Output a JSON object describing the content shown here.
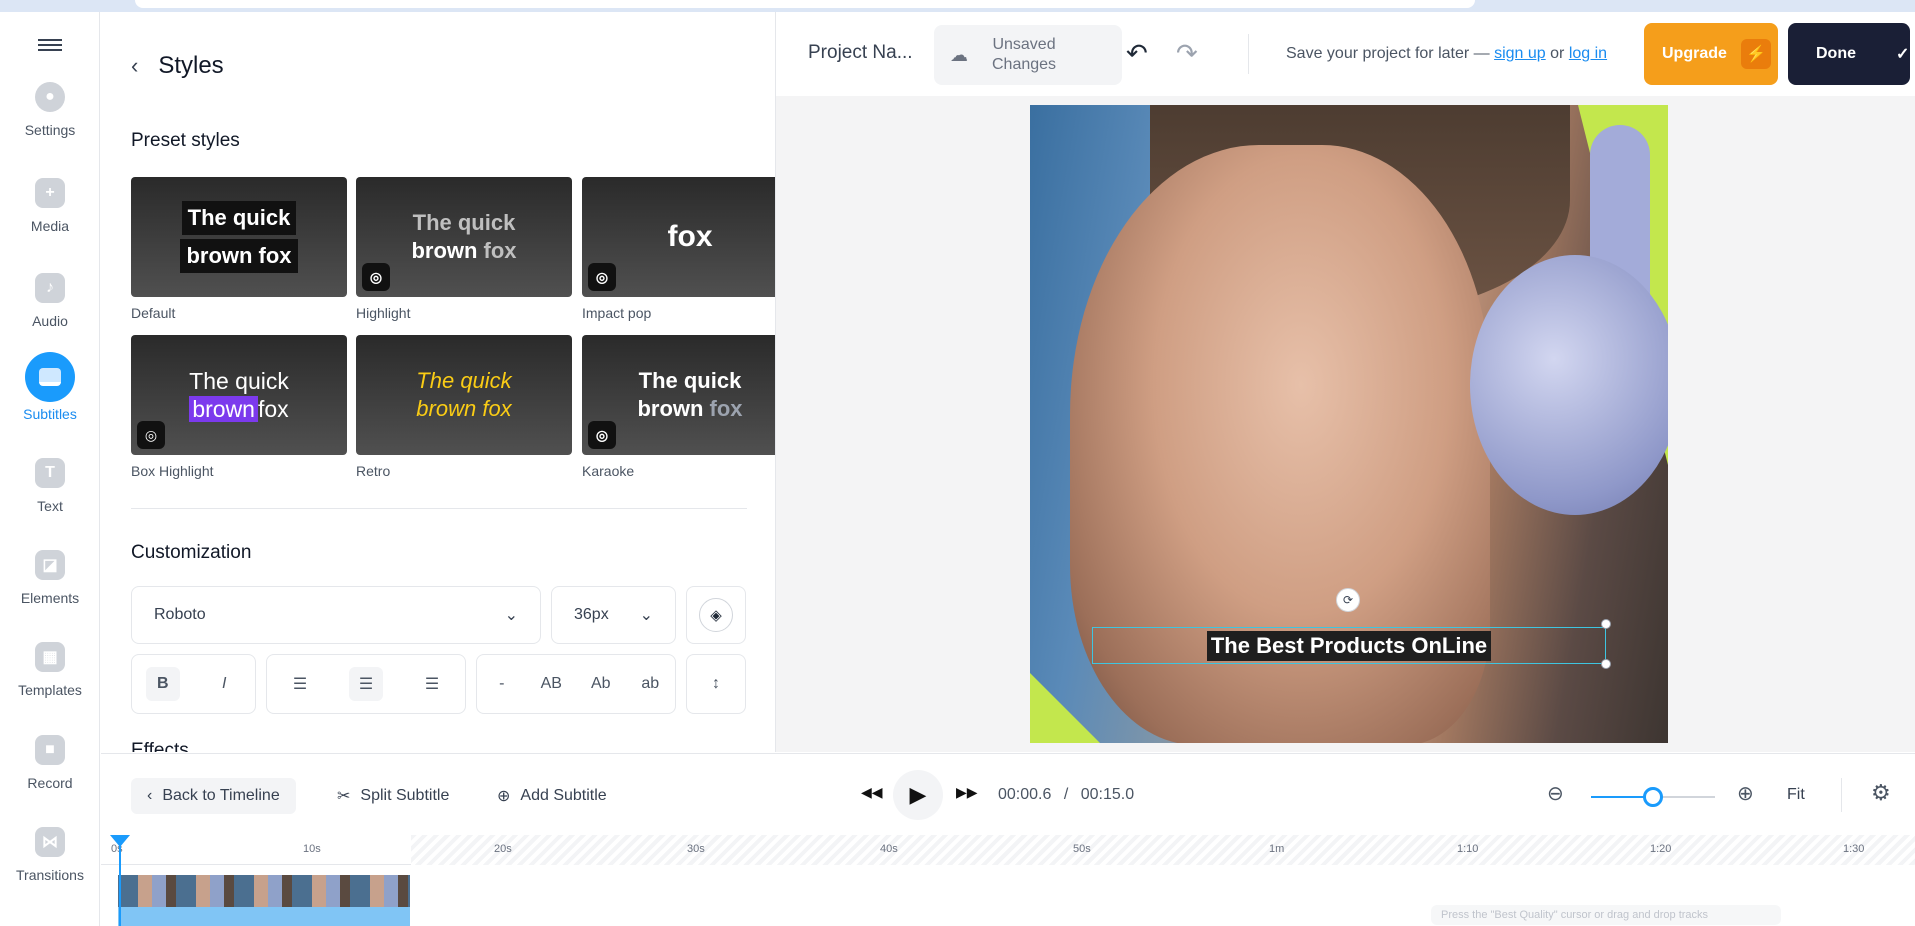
{
  "rail": {
    "items": [
      {
        "label": "Settings",
        "icon": "gear-icon"
      },
      {
        "label": "Media",
        "icon": "plus-icon"
      },
      {
        "label": "Audio",
        "icon": "music-note-icon"
      },
      {
        "label": "Subtitles",
        "icon": "subtitles-icon",
        "active": true
      },
      {
        "label": "Text",
        "icon": "text-icon"
      },
      {
        "label": "Elements",
        "icon": "sticker-icon"
      },
      {
        "label": "Templates",
        "icon": "template-icon"
      },
      {
        "label": "Record",
        "icon": "camera-icon"
      },
      {
        "label": "Transitions",
        "icon": "bowtie-icon"
      }
    ]
  },
  "panel": {
    "title": "Styles",
    "preset_title": "Preset styles",
    "presets": [
      {
        "label": "Default",
        "line1": "The quick",
        "line2": "brown fox"
      },
      {
        "label": "Highlight",
        "line1": "The quick",
        "line2a": "brown ",
        "line2b": "fox"
      },
      {
        "label": "Impact pop",
        "text": "fox"
      },
      {
        "label": "Box Highlight",
        "line1": "The quick",
        "line2a": "brown",
        "line2b": "fox"
      },
      {
        "label": "Retro",
        "line1": "The quick",
        "line2": "brown fox"
      },
      {
        "label": "Karaoke",
        "line1": "The quick",
        "line2a": "brown ",
        "line2b": "fox"
      }
    ],
    "customization_title": "Customization",
    "font": "Roboto",
    "font_size": "36px",
    "format": {
      "bold": "B",
      "italic": "I",
      "minus": "-",
      "upper": "AB",
      "title": "Ab",
      "lower": "ab"
    },
    "effects_title": "Effects"
  },
  "topbar": {
    "project_name": "Project Na...",
    "unsaved_line1": "Unsaved",
    "unsaved_line2": "Changes",
    "save_msg": "Save your project for later —",
    "sign_up": "sign up",
    "or": "or",
    "log_in": "log in",
    "upgrade": "Upgrade",
    "done": "Done"
  },
  "canvas": {
    "caption": "The Best Products OnLine"
  },
  "controls": {
    "back_to_timeline": "Back to Timeline",
    "split_subtitle": "Split Subtitle",
    "add_subtitle": "Add Subtitle",
    "current_time": "00:00.6",
    "separator": "/",
    "total_time": "00:15.0",
    "fit": "Fit"
  },
  "timeline": {
    "ticks": [
      "0s",
      "10s",
      "20s",
      "30s",
      "40s",
      "50s",
      "1m",
      "1:10",
      "1:20",
      "1:30"
    ],
    "hint": "Press the \"Best Quality\" cursor or drag and drop tracks"
  },
  "colors": {
    "accent": "#1a9bfc",
    "upgrade": "#f59e1b",
    "done": "#1a1f36",
    "lime": "#c3e74d"
  }
}
